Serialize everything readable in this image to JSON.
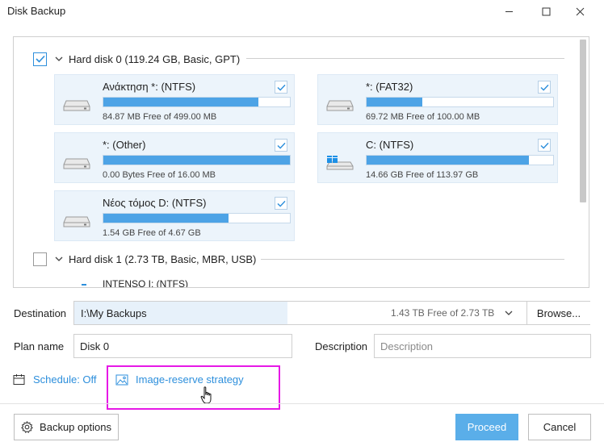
{
  "window": {
    "title": "Disk Backup"
  },
  "disks": [
    {
      "label": "Hard disk 0 (119.24 GB, Basic, GPT)",
      "checked": true,
      "partitions": [
        {
          "name": "Ανάκτηση *: (NTFS)",
          "free": "84.87 MB Free of 499.00 MB",
          "used_fraction": 0.83,
          "checked": true,
          "icon": "drive-icon"
        },
        {
          "name": "*: (FAT32)",
          "free": "69.72 MB Free of 100.00 MB",
          "used_fraction": 0.3,
          "checked": true,
          "icon": "drive-icon"
        },
        {
          "name": "*: (Other)",
          "free": "0.00 Bytes Free of 16.00 MB",
          "used_fraction": 1.0,
          "checked": true,
          "icon": "drive-icon"
        },
        {
          "name": "C: (NTFS)",
          "free": "14.66 GB Free of 113.97 GB",
          "used_fraction": 0.87,
          "checked": true,
          "icon": "windows-drive-icon"
        },
        {
          "name": "Νέος τόμος D: (NTFS)",
          "free": "1.54 GB Free of 4.67 GB",
          "used_fraction": 0.67,
          "checked": true,
          "icon": "drive-icon"
        }
      ]
    },
    {
      "label": "Hard disk 1 (2.73 TB, Basic, MBR, USB)",
      "checked": false,
      "partitions": [
        {
          "name": "INTENSO I: (NTFS)"
        }
      ]
    }
  ],
  "destination": {
    "label": "Destination",
    "path": "I:\\My Backups",
    "free": "1.43 TB Free of 2.73 TB",
    "browse_label": "Browse..."
  },
  "plan": {
    "label": "Plan name",
    "value": "Disk 0"
  },
  "description": {
    "label": "Description",
    "placeholder": "Description"
  },
  "schedule": {
    "label": "Schedule: Off",
    "icon": "calendar-icon"
  },
  "image_reserve": {
    "label": "Image-reserve strategy",
    "icon": "image-icon"
  },
  "footer": {
    "backup_options_label": "Backup options",
    "proceed_label": "Proceed",
    "cancel_label": "Cancel"
  },
  "colors": {
    "accent": "#2d8fdc",
    "bar_fill": "#4da3e6",
    "partition_bg": "#ecf4fb",
    "highlight": "#e619e6",
    "primary_button": "#5aaee9"
  }
}
